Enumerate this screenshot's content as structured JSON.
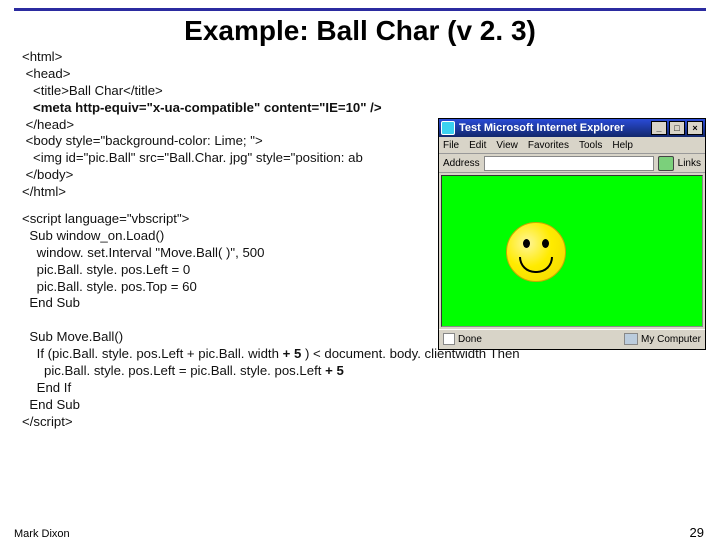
{
  "title": "Example: Ball Char (v 2. 3)",
  "code1": [
    "<html>",
    " <head>",
    "   <title>Ball Char</title>",
    "   <meta http-equiv=\"x-ua-compatible\" content=\"IE=10\" />",
    " </head>",
    " <body style=\"background-color: Lime; \">",
    "   <img id=\"pic.Ball\" src=\"Ball.Char. jpg\" style=\"position: ab",
    " </body>",
    "</html>"
  ],
  "code2": [
    "<script language=\"vbscript\">",
    "  Sub window_on.Load()",
    "    window. set.Interval \"Move.Ball( )\", 500",
    "    pic.Ball. style. pos.Left = 0",
    "    pic.Ball. style. pos.Top = 60",
    "  End Sub",
    "",
    "  Sub Move.Ball()",
    "    If (pic.Ball. style. pos.Left + pic.Ball. width + 5 ) < document. body. clientwidth Then",
    "      pic.Ball. style. pos.Left = pic.Ball. style. pos.Left + 5",
    "    End If",
    "  End Sub",
    "</script>"
  ],
  "bold_code1_line": 3,
  "bold_code2_marker": "+ 5",
  "footer_left": "Mark Dixon",
  "footer_right": "29",
  "ie": {
    "title": "Test   Microsoft Internet Explorer",
    "menu": [
      "File",
      "Edit",
      "View",
      "Favorites",
      "Tools",
      "Help"
    ],
    "addr_label": "Address",
    "addr_url": "",
    "links_label": "Links",
    "status_done": "Done",
    "status_zone": "My Computer"
  }
}
